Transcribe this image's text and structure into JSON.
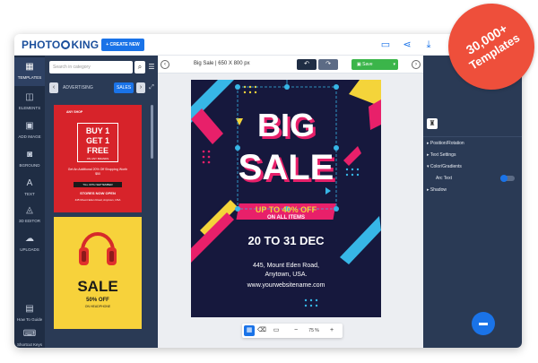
{
  "app": {
    "logo_a": "PHOTO",
    "logo_b": "KING",
    "create_label": "+ CREATE NEW"
  },
  "ribbon": {
    "line1": "30,000+",
    "line2": "Templates"
  },
  "tools": [
    {
      "label": "TEMPLATES",
      "icon": "templates-icon"
    },
    {
      "label": "ELEMENTS",
      "icon": "elements-icon"
    },
    {
      "label": "ADD IMAGE",
      "icon": "add-image-icon"
    },
    {
      "label": "BGROUND",
      "icon": "background-icon"
    },
    {
      "label": "TEXT",
      "icon": "text-icon"
    },
    {
      "label": "3D EDITOR",
      "icon": "3d-editor-icon"
    },
    {
      "label": "UPLOADS",
      "icon": "uploads-icon"
    }
  ],
  "bottom_tools": [
    {
      "label": "How To Guide"
    },
    {
      "label": "Shortcut Keys"
    }
  ],
  "panel": {
    "search_placeholder": "Search in category",
    "categories": [
      "ADVERTISING",
      "SALES"
    ],
    "thumb1": {
      "shop": "ANY SHOP",
      "buy": "BUY 1",
      "get": "GET 1",
      "free": "FREE",
      "sub": "ON ANY BRANDS",
      "offer": "Get An Additional 20% Off Shopping Worth $50",
      "till": "TILL 30TH SEPTEMBER",
      "stores": "STORES NOW OPEN",
      "addr": "445 Mount Eden Road, Anytown, USA"
    },
    "thumb2": {
      "sale": "SALE",
      "off": "50% OFF",
      "on": "ON HEADPHONE"
    }
  },
  "workspace": {
    "title": "Big Sale | 650 X 800 px",
    "save_label": "Save",
    "zoom": "75 %",
    "poster": {
      "big": "BIG",
      "sale": "SALE",
      "upto": "UP TO 40% OFF",
      "all": "ON ALL ITEMS",
      "dates": "20 TO 31 DEC",
      "addr1": "445, Mount Eden Road,",
      "addr2": "Anytown, USA.",
      "web": "www.yourwebsitename.com"
    }
  },
  "right_panel": {
    "items": [
      "Position/Rotation",
      "Text Settings",
      "Color/Gradients",
      "Arc Text",
      "Shadow"
    ]
  },
  "colors": {
    "accent": "#1a73e8",
    "rail": "#1f2d44",
    "panel": "#2a3a55",
    "poster_bg": "#16183d",
    "pink": "#e8206a",
    "ribbon": "#ee4f3b"
  }
}
